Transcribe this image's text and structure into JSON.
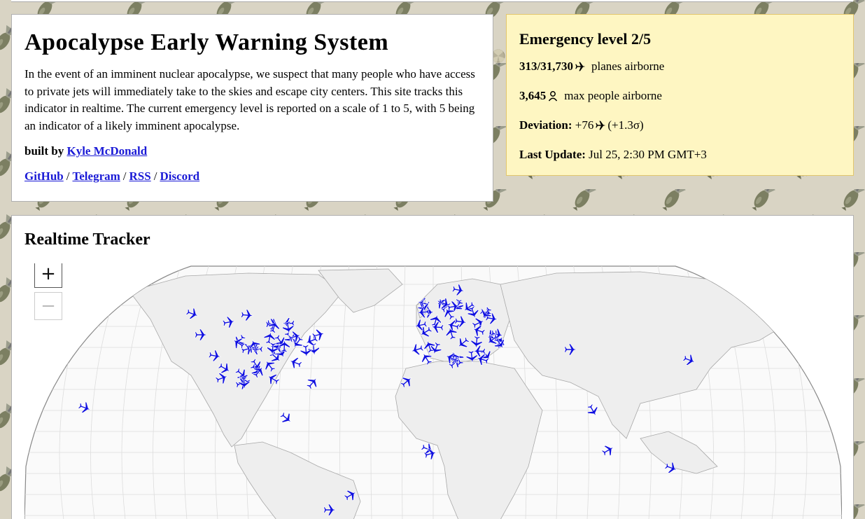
{
  "intro": {
    "title": "Apocalypse Early Warning System",
    "description": "In the event of an imminent nuclear apocalypse, we suspect that many people who have access to private jets will immediately take to the skies and escape city centers. This site tracks this indicator in realtime. The current emergency level is reported on a scale of 1 to 5, with 5 being an indicator of a likely imminent apocalypse.",
    "built_by_label": "built by",
    "author": "Kyle McDonald",
    "links": [
      "GitHub",
      "Telegram",
      "RSS",
      "Discord"
    ],
    "link_separator": "/"
  },
  "status": {
    "heading": "Emergency level 2/5",
    "planes_value": "313/31,730",
    "planes_label": "planes airborne",
    "people_value": "3,645",
    "people_label": "max people airborne",
    "deviation_label": "Deviation:",
    "deviation_value": "+76",
    "deviation_sigma": "(+1.3σ)",
    "last_update_label": "Last Update:",
    "last_update_value": "Jul 25, 2:30 PM GMT+3",
    "colors": {
      "panel_bg": "#fef6c2",
      "panel_border": "#e2c66d"
    }
  },
  "tracker": {
    "heading": "Realtime Tracker",
    "zoom_in": "+",
    "zoom_out": "−",
    "plane_color": "#1010e0",
    "icons": [
      "plane-icon",
      "person-icon",
      "radiation-icon",
      "bomb-icon"
    ]
  }
}
